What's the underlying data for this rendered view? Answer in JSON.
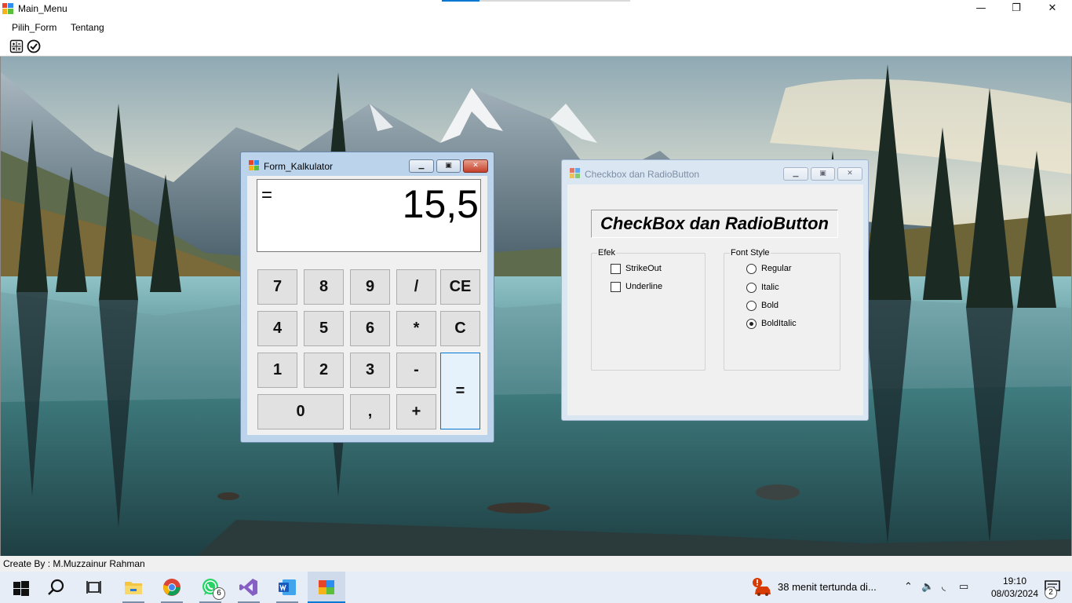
{
  "window": {
    "title": "Main_Menu",
    "controls": {
      "minimize": "—",
      "maximize": "❐",
      "close": "✕"
    }
  },
  "menu": {
    "items": [
      "Pilih_Form",
      "Tentang"
    ]
  },
  "toolbar": {
    "icons": [
      "calculator-icon",
      "checkmark-circle-icon"
    ]
  },
  "status": {
    "text": "Create By : M.Muzzainur Rahman"
  },
  "calculator": {
    "title": "Form_Kalkulator",
    "display": {
      "operator": "=",
      "value": "15,5"
    },
    "keys": {
      "k7": "7",
      "k8": "8",
      "k9": "9",
      "div": "/",
      "ce": "CE",
      "k4": "4",
      "k5": "5",
      "k6": "6",
      "mul": "*",
      "c": "C",
      "k1": "1",
      "k2": "2",
      "k3": "3",
      "sub": "-",
      "eq": "=",
      "k0": "0",
      "comma": ",",
      "add": "+"
    }
  },
  "checkbox_form": {
    "title": "Checkbox dan RadioButton",
    "heading": "CheckBox dan RadioButton",
    "efek": {
      "legend": "Efek",
      "options": [
        {
          "label": "StrikeOut",
          "checked": false
        },
        {
          "label": "Underline",
          "checked": false
        }
      ]
    },
    "font_style": {
      "legend": "Font Style",
      "options": [
        {
          "label": "Regular",
          "checked": false
        },
        {
          "label": "Italic",
          "checked": false
        },
        {
          "label": "Bold",
          "checked": false
        },
        {
          "label": "BoldItalic",
          "checked": true
        }
      ]
    }
  },
  "taskbar": {
    "apps": [
      "start-icon",
      "search-icon",
      "task-view-icon",
      "file-explorer-icon",
      "chrome-icon",
      "whatsapp-icon",
      "visual-studio-icon",
      "word-icon",
      "winforms-app-icon"
    ],
    "whatsapp_badge": "6",
    "notification": "38 menit tertunda di...",
    "time": "19:10",
    "date": "08/03/2024",
    "action_center_badge": "2"
  },
  "colors": {
    "accent": "#0078d4",
    "taskbar": "#e7edf6",
    "calc_frame": "#bcd3ec"
  }
}
